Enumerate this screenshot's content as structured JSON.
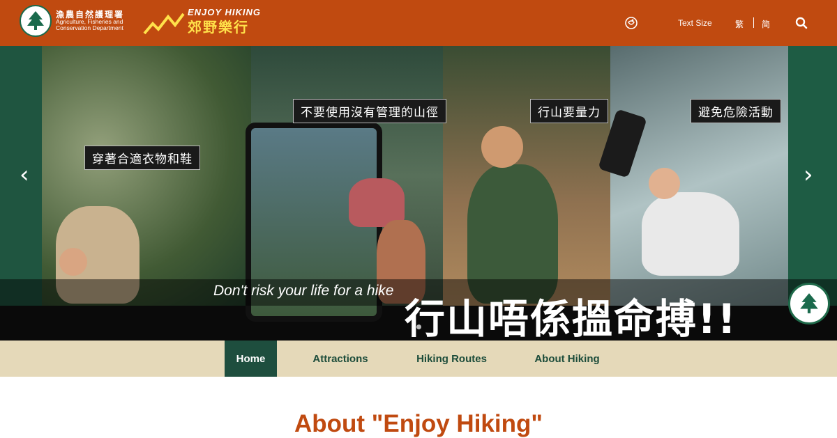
{
  "header": {
    "org_name_zh": "漁農自然護理署",
    "org_name_en_line1": "Agriculture, Fisheries and",
    "org_name_en_line2": "Conservation Department",
    "site_title_en": "ENJOY HIKING",
    "site_title_zh": "郊野樂行",
    "text_size_label": "Text Size",
    "lang_traditional": "繁",
    "lang_simplified": "简"
  },
  "banner": {
    "callouts": [
      "穿著合適衣物和鞋",
      "不要使用沒有管理的山徑",
      "行山要量力",
      "避免危險活動"
    ],
    "slogan_en": "Don't risk your life for a hike",
    "slogan_zh": "行山唔係搵命搏!!",
    "prev_arrow": "‹",
    "next_arrow": "›"
  },
  "nav": {
    "items": [
      "Home",
      "Attractions",
      "Hiking Routes",
      "About Hiking"
    ],
    "active": "Home"
  },
  "main": {
    "title": "About \"Enjoy Hiking\""
  },
  "colors": {
    "header_bg": "#c04a10",
    "nav_bg": "#e5d9b9",
    "nav_active_bg": "#1e4e3e",
    "nav_text": "#1c4c3a",
    "title_color": "#c04a10"
  }
}
